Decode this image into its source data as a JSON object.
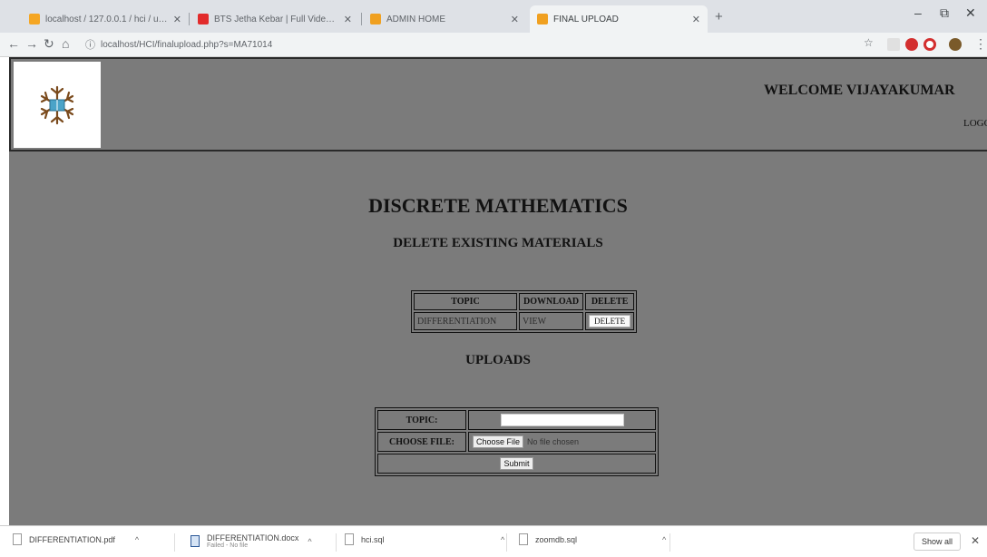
{
  "browser": {
    "tabs": [
      {
        "title": "localhost / 127.0.0.1 / hci / upl...",
        "favicon_color": "#f5a623"
      },
      {
        "title": "BTS Jetha Kebar | Full Video So...",
        "favicon_color": "#e22b2b"
      },
      {
        "title": "ADMIN HOME",
        "favicon_color": "#f0a020"
      },
      {
        "title": "FINAL UPLOAD",
        "favicon_color": "#f0a020"
      }
    ],
    "url": "localhost/HCI/finalupload.php?s=MA71014"
  },
  "page": {
    "welcome_text": "WELCOME VIJAYAKUMAR",
    "logout_text": "LOGOUT",
    "subject_title": "DISCRETE MATHEMATICS",
    "delete_heading": "DELETE EXISTING MATERIALS",
    "materials_table": {
      "headers": [
        "TOPIC",
        "DOWNLOAD",
        "DELETE"
      ],
      "rows": [
        {
          "topic": "DIFFERENTIATION",
          "download": "VIEW",
          "delete": "DELETE"
        }
      ]
    },
    "uploads_heading": "UPLOADS",
    "upload_form": {
      "topic_label": "TOPIC:",
      "topic_value": "",
      "file_label": "CHOOSE FILE:",
      "choose_button": "Choose File",
      "no_file_text": "No file chosen",
      "submit_label": "Submit"
    },
    "background_color": "#7b7b7b"
  },
  "downloads": [
    {
      "name": "DIFFERENTIATION.pdf",
      "sub": ""
    },
    {
      "name": "DIFFERENTIATION.docx",
      "sub": "Failed - No file"
    },
    {
      "name": "hci.sql",
      "sub": ""
    },
    {
      "name": "zoomdb.sql",
      "sub": ""
    }
  ],
  "downloads_show_all": "Show all"
}
